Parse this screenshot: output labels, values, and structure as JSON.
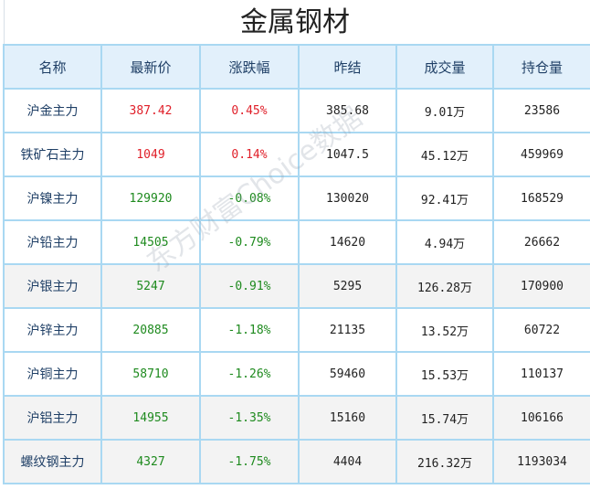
{
  "page": {
    "title": "金属钢材"
  },
  "table": {
    "headers": [
      "名称",
      "最新价",
      "涨跌幅",
      "昨结",
      "成交量",
      "持仓量"
    ],
    "rows": [
      {
        "name": "沪金主力",
        "last": "387.42",
        "change": "0.45%",
        "prev_settle": "385.68",
        "volume": "9.01万",
        "open_interest": "23586",
        "direction": "up"
      },
      {
        "name": "铁矿石主力",
        "last": "1049",
        "change": "0.14%",
        "prev_settle": "1047.5",
        "volume": "45.12万",
        "open_interest": "459969",
        "direction": "up"
      },
      {
        "name": "沪镍主力",
        "last": "129920",
        "change": "-0.08%",
        "prev_settle": "130020",
        "volume": "92.41万",
        "open_interest": "168529",
        "direction": "down"
      },
      {
        "name": "沪铅主力",
        "last": "14505",
        "change": "-0.79%",
        "prev_settle": "14620",
        "volume": "4.94万",
        "open_interest": "26662",
        "direction": "down"
      },
      {
        "name": "沪银主力",
        "last": "5247",
        "change": "-0.91%",
        "prev_settle": "5295",
        "volume": "126.28万",
        "open_interest": "170900",
        "direction": "down"
      },
      {
        "name": "沪锌主力",
        "last": "20885",
        "change": "-1.18%",
        "prev_settle": "21135",
        "volume": "13.52万",
        "open_interest": "60722",
        "direction": "down"
      },
      {
        "name": "沪铜主力",
        "last": "58710",
        "change": "-1.26%",
        "prev_settle": "59460",
        "volume": "15.53万",
        "open_interest": "110137",
        "direction": "down"
      },
      {
        "name": "沪铝主力",
        "last": "14955",
        "change": "-1.35%",
        "prev_settle": "15160",
        "volume": "15.74万",
        "open_interest": "106166",
        "direction": "down"
      },
      {
        "name": "螺纹钢主力",
        "last": "4327",
        "change": "-1.75%",
        "prev_settle": "4404",
        "volume": "216.32万",
        "open_interest": "1193034",
        "direction": "down"
      }
    ]
  },
  "watermark": {
    "text": "东方财富Choice数据"
  },
  "colors": {
    "up": "#e0202a",
    "down": "#1e8a1e",
    "header_bg": "#e2f0fb",
    "border": "#a9d8f2"
  }
}
